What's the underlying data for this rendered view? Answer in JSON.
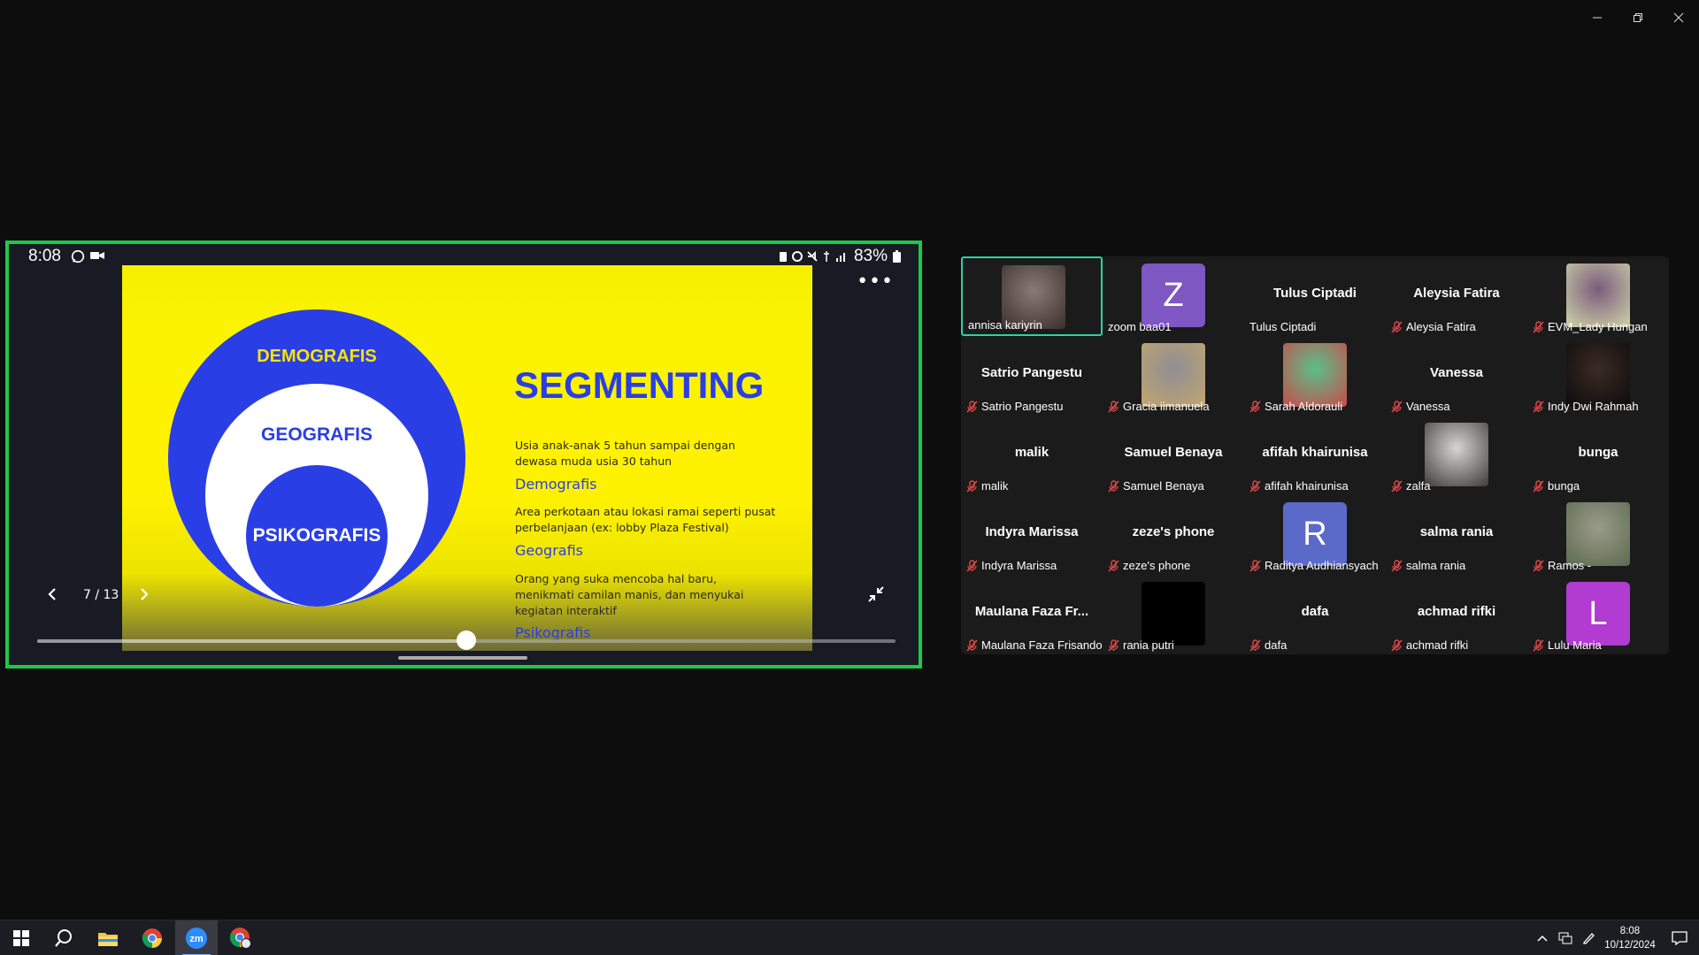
{
  "window": {
    "controls": {
      "minimize_icon": "minimize-icon",
      "restore_icon": "restore-icon",
      "close_icon": "close-icon"
    }
  },
  "phone_status": {
    "time": "8:08",
    "battery": "83%"
  },
  "slide": {
    "title": "SEGMENTING",
    "circle_outer": "DEMOGRAFIS",
    "circle_mid": "GEOGRAFIS",
    "circle_inner": "PSIKOGRAFIS",
    "items": [
      {
        "text": "Usia anak-anak 5 tahun sampai dengan dewasa muda usia 30 tahun",
        "label": "Demografis"
      },
      {
        "text": "Area perkotaan atau lokasi ramai seperti pusat perbelanjaan (ex: lobby Plaza Festival)",
        "label": "Geografis"
      },
      {
        "text": "Orang yang suka mencoba hal baru, menikmati camilan manis, dan menyukai kegiatan interaktif",
        "label": "Psikografis"
      }
    ],
    "colors": {
      "yellow": "#fff200",
      "blue": "#2a3ee6"
    }
  },
  "viewer": {
    "page_indicator": "7 / 13",
    "progress": 0.5
  },
  "participants": [
    {
      "name": "annisa kariyrin",
      "display": "",
      "muted": false,
      "avatar": "photo",
      "active": true
    },
    {
      "name": "zoom baa01",
      "display": "",
      "muted": false,
      "avatar": "letter",
      "letter": "Z",
      "color": "#7e57c2"
    },
    {
      "name": "Tulus Ciptadi",
      "display": "Tulus Ciptadi",
      "muted": false,
      "avatar": "none"
    },
    {
      "name": "Aleysia Fatira",
      "display": "Aleysia Fatira",
      "muted": true,
      "avatar": "none"
    },
    {
      "name": "EVM_Lady Hungan",
      "display": "",
      "muted": true,
      "avatar": "photo"
    },
    {
      "name": "Satrio Pangestu",
      "display": "Satrio Pangestu",
      "muted": true,
      "avatar": "none"
    },
    {
      "name": "Gracia iimanuela",
      "display": "",
      "muted": true,
      "avatar": "photo"
    },
    {
      "name": "Sarah Aldorauli",
      "display": "",
      "muted": true,
      "avatar": "photo"
    },
    {
      "name": "Vanessa",
      "display": "Vanessa",
      "muted": true,
      "avatar": "none"
    },
    {
      "name": "Indy Dwi Rahmah",
      "display": "",
      "muted": true,
      "avatar": "photo"
    },
    {
      "name": "malik",
      "display": "malik",
      "muted": true,
      "avatar": "none"
    },
    {
      "name": "Samuel Benaya",
      "display": "Samuel Benaya",
      "muted": true,
      "avatar": "none"
    },
    {
      "name": "afifah khairunisa",
      "display": "afifah khairunisa",
      "muted": true,
      "avatar": "none"
    },
    {
      "name": "zalfa",
      "display": "",
      "muted": true,
      "avatar": "photo"
    },
    {
      "name": "bunga",
      "display": "bunga",
      "muted": true,
      "avatar": "none"
    },
    {
      "name": "Indyra Marissa",
      "display": "Indyra Marissa",
      "muted": true,
      "avatar": "none"
    },
    {
      "name": "zeze's phone",
      "display": "zeze's phone",
      "muted": true,
      "avatar": "none"
    },
    {
      "name": "Raditya Audhiansyach",
      "display": "",
      "muted": true,
      "avatar": "letter",
      "letter": "R",
      "color": "#5b6ac9"
    },
    {
      "name": "salma rania",
      "display": "salma rania",
      "muted": true,
      "avatar": "none"
    },
    {
      "name": "Ramos -",
      "display": "",
      "muted": true,
      "avatar": "photo"
    },
    {
      "name": "Maulana Faza Frisando",
      "display": "Maulana Faza Fr...",
      "muted": true,
      "avatar": "none"
    },
    {
      "name": "rania putri",
      "display": "",
      "muted": true,
      "avatar": "black"
    },
    {
      "name": "dafa",
      "display": "dafa",
      "muted": true,
      "avatar": "none"
    },
    {
      "name": "achmad rifki",
      "display": "achmad rifki",
      "muted": true,
      "avatar": "none"
    },
    {
      "name": "Lulu Maria",
      "display": "",
      "muted": true,
      "avatar": "letter",
      "letter": "L",
      "color": "#b23bd1"
    }
  ],
  "taskbar": {
    "apps": [
      "start-icon",
      "search-icon",
      "file-explorer-icon",
      "chrome-icon",
      "zoom-icon",
      "chrome-profile-icon"
    ],
    "clock_time": "8:08",
    "clock_date": "10/12/2024"
  }
}
